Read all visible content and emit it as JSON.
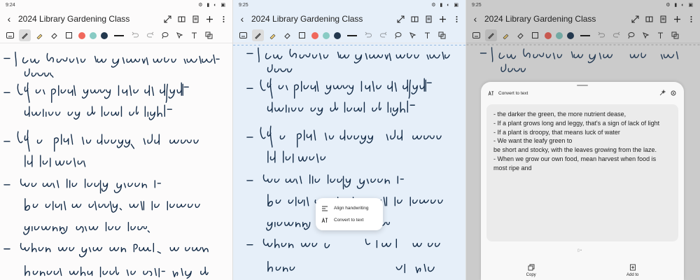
{
  "app": {
    "title": "2024 Library Gardening Class"
  },
  "panels": [
    {
      "time": "9:24"
    },
    {
      "time": "9:25"
    },
    {
      "time": "9:25"
    }
  ],
  "icons": {
    "back": "arrow-left-icon",
    "topbar": [
      "expand-icon",
      "book-icon",
      "page-icon",
      "add-icon",
      "more-icon"
    ],
    "toolbar": [
      "keyboard-icon",
      "pen-icon",
      "highlighter-icon",
      "eraser-icon",
      "shapes-icon",
      "undo-icon",
      "redo-icon",
      "lasso-icon",
      "selection-icon",
      "text-icon",
      "layers-icon"
    ]
  },
  "colors": {
    "swatches": [
      "#f0685c",
      "#88cbc4",
      "#23384e"
    ],
    "ink": "#142c48"
  },
  "notes": {
    "lines": [
      "- Ile darker the green, the more nutrient dense.",
      "- If a plant grows long and leggy, that's a sign of lack of light",
      "- If a plant is droopy, that means lack of water",
      "- We want the leafy green to be short and stocky, with the leaves growing from the base.",
      "- When we grow our own food, we can harvest when food is most ripe and"
    ]
  },
  "popup": {
    "align_label": "Align handwriting",
    "convert_label": "Convert to text"
  },
  "convert_sheet": {
    "title": "Convert to text",
    "lines": [
      "- the darker the green, the more nutrient dease,",
      "- If a plant grows long and leggy, that's a sign of lack of light",
      "- If a plant is droopy, that means luck of water",
      "- We want the leafy green to",
      "be short and stocky, with the leaves growing from the laze.",
      "- When we grow our own food, mean harvest when food is",
      "most ripe and"
    ],
    "copy_label": "Copy",
    "add_label": "Add to"
  }
}
